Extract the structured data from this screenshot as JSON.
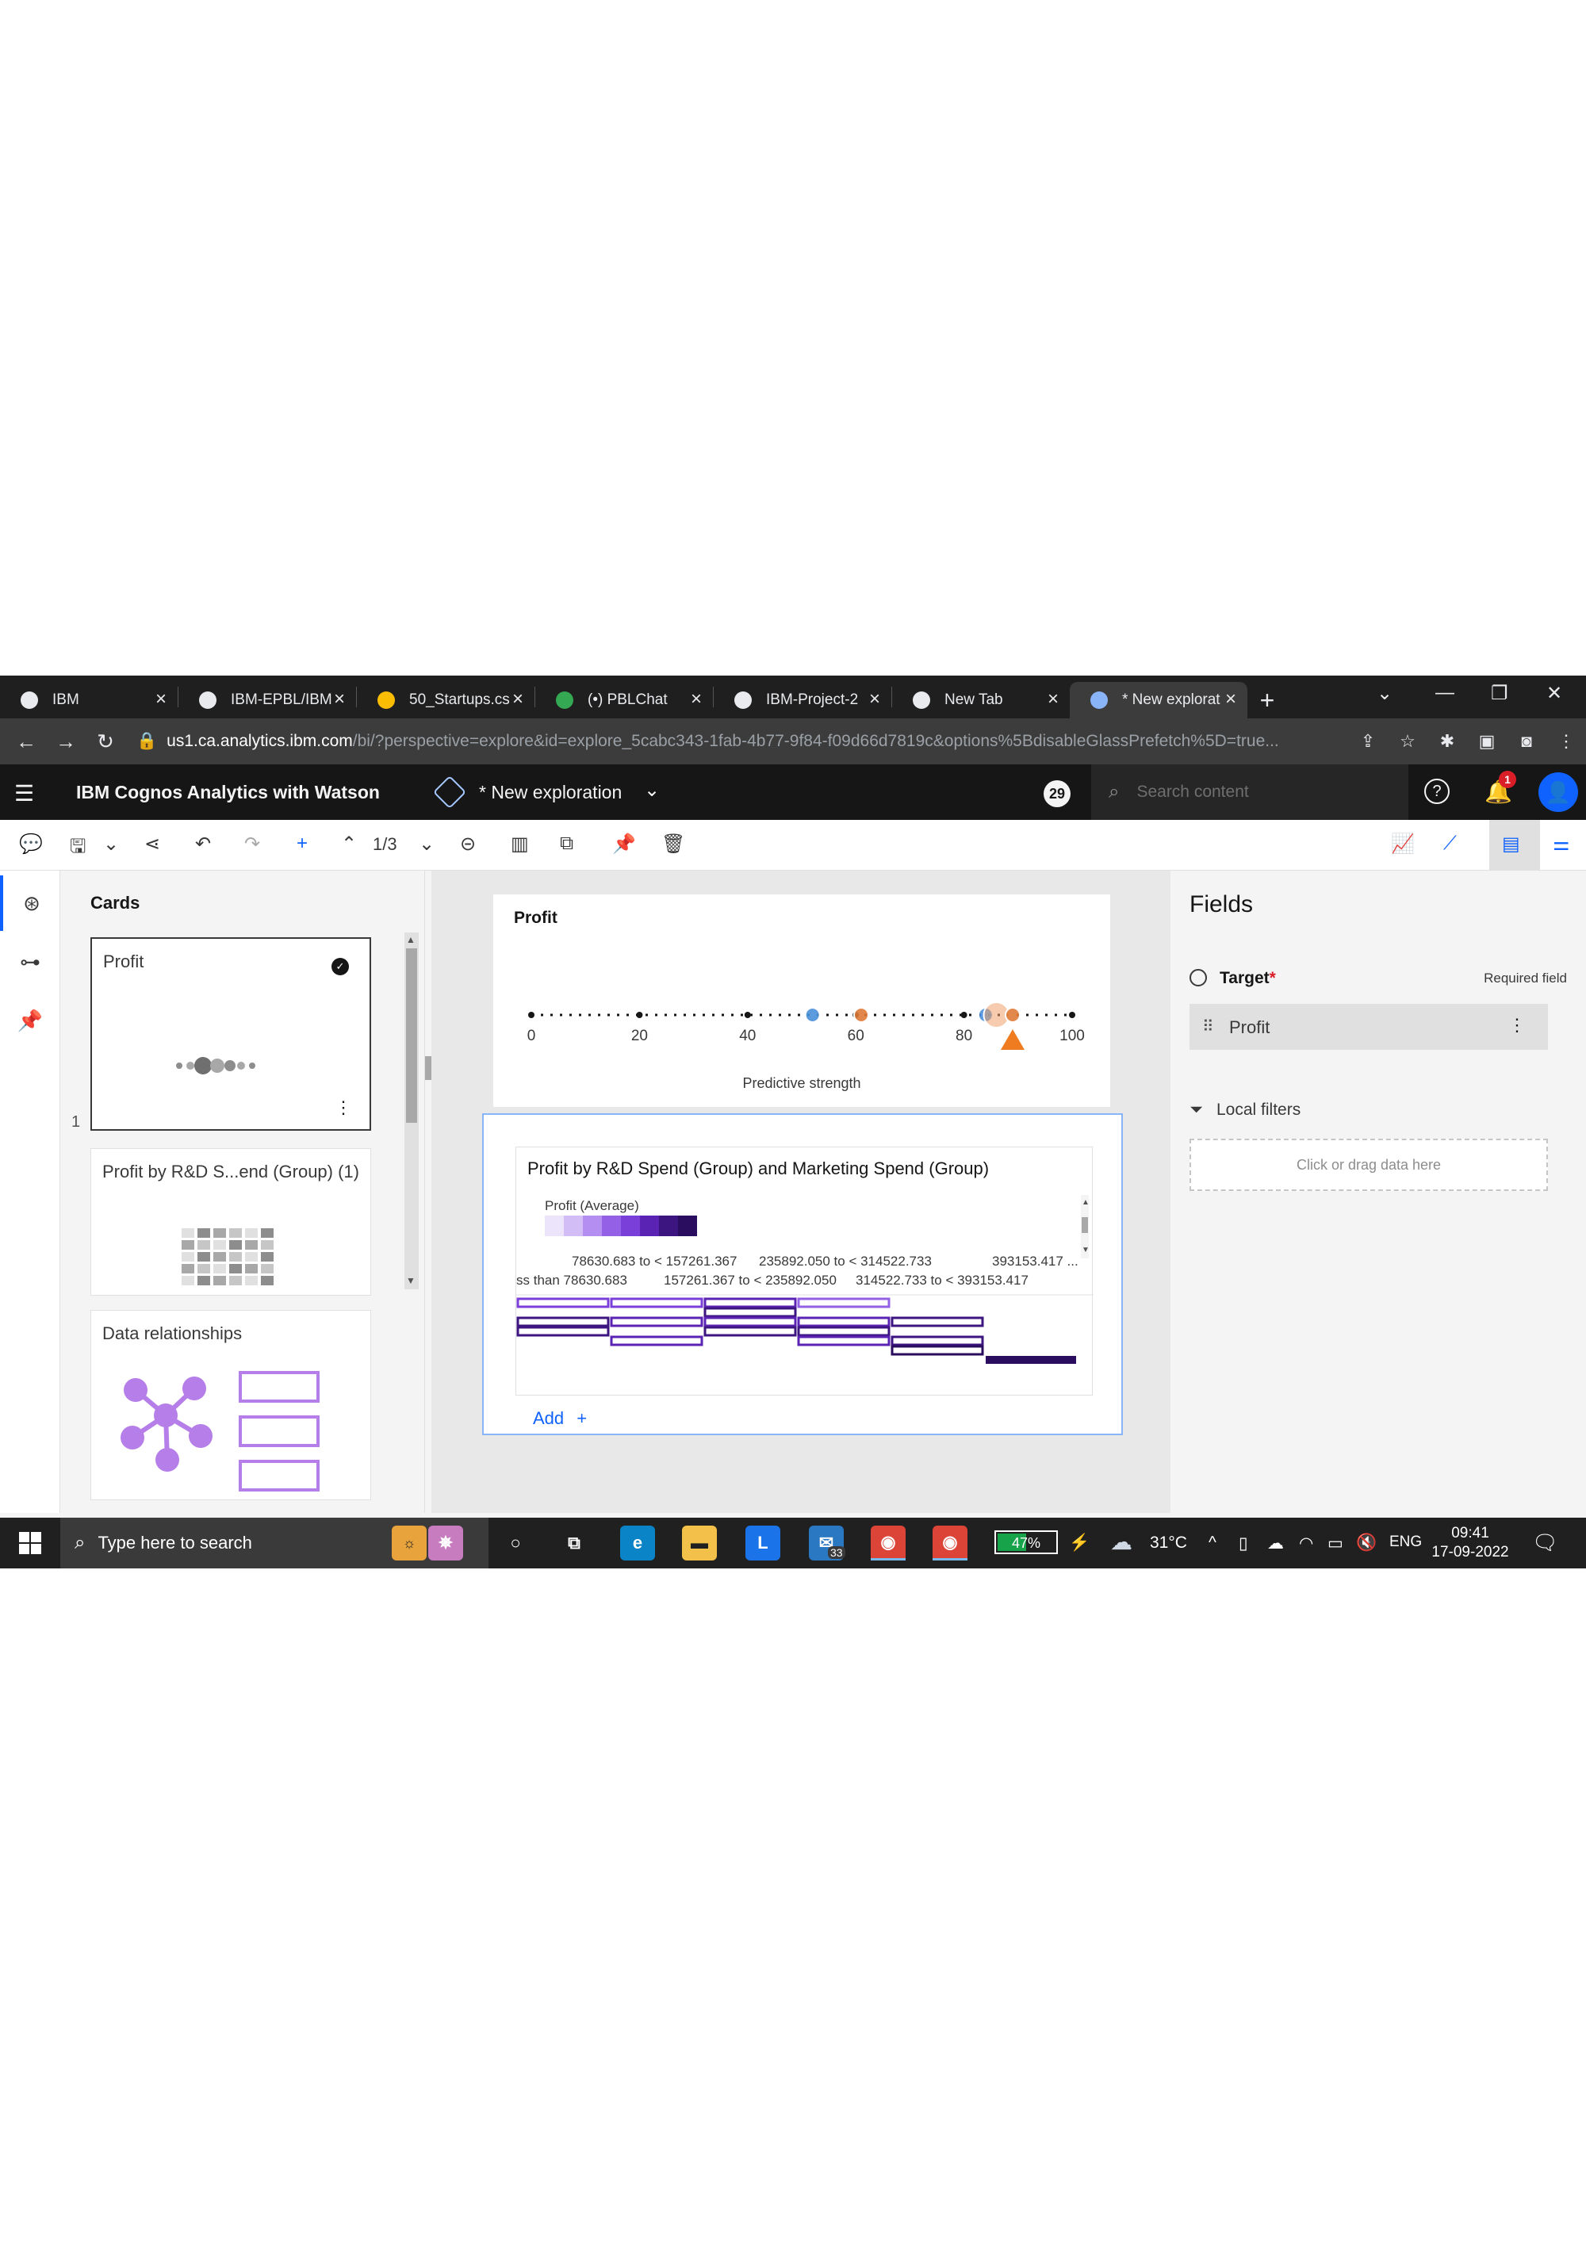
{
  "browser": {
    "tabs": [
      {
        "label": "IBM",
        "icon": "ibm-icon",
        "icon_color": "#e8eaed"
      },
      {
        "label": "IBM-EPBL/IBM",
        "icon": "github-icon",
        "icon_color": "#e8eaed"
      },
      {
        "label": "50_Startups.cs",
        "icon": "google-drive-icon",
        "icon_color": "#fbbc04"
      },
      {
        "label": "(•) PBLChat",
        "icon": "chat-icon",
        "icon_color": "#34a853"
      },
      {
        "label": "IBM-Project-2",
        "icon": "github-icon",
        "icon_color": "#e8eaed"
      },
      {
        "label": "New Tab",
        "icon": "chrome-icon",
        "icon_color": "#e8eaed"
      },
      {
        "label": "* New explorat",
        "icon": "cognos-icon",
        "icon_color": "#8ab4f8",
        "active": true
      }
    ],
    "new_tab_symbol": "+",
    "url_host": "us1.ca.analytics.ibm.com",
    "url_path": "/bi/?perspective=explore&id=explore_5cabc343-1fab-4b77-9f84-f09d66d7819c&options%5BdisableGlassPrefetch%5D=true..."
  },
  "app": {
    "product_title": "IBM Cognos Analytics with Watson",
    "exploration_name": "* New exploration",
    "counter": "29",
    "search_placeholder": "Search content",
    "notification_count": "1"
  },
  "toolbar": {
    "page_indicator": "1/3"
  },
  "cards_panel": {
    "title": "Cards",
    "cards": [
      {
        "title": "Profit",
        "number": "1",
        "selected": true
      },
      {
        "title": "Profit by R&D S...end (Group) (1)"
      },
      {
        "title": "Data relationships"
      }
    ]
  },
  "predictive_card": {
    "title": "Profit",
    "axis_label": "Predictive strength",
    "ticks": [
      "0",
      "20",
      "40",
      "60",
      "80",
      "100"
    ]
  },
  "chart_data": {
    "type": "scatter",
    "title": "Profit",
    "xlabel": "Predictive strength",
    "xlim": [
      0,
      100
    ],
    "points": [
      {
        "x": 52,
        "color": "#4a90d9"
      },
      {
        "x": 61,
        "color": "#e07b39"
      },
      {
        "x": 84,
        "color": "#4a90d9"
      },
      {
        "x": 86,
        "color": "#f0a06a"
      },
      {
        "x": 89,
        "color": "#e07b39"
      }
    ],
    "marker_x": 89
  },
  "heatmap_card": {
    "title": "Profit by R&D Spend (Group) and Marketing Spend (Group)",
    "legend_title": "Profit (Average)",
    "legend_colors": [
      "#ece4fb",
      "#d2bdf7",
      "#b48ef0",
      "#9461e6",
      "#7b3fd9",
      "#5b23b3",
      "#3d1580",
      "#2a0d5e"
    ],
    "col_labels_top": [
      "78630.683 to < 157261.367",
      "235892.050 to < 314522.733",
      "393153.417 ..."
    ],
    "col_labels_bottom": [
      "ss than 78630.683",
      "157261.367 to < 235892.050",
      "314522.733 to < 393153.417"
    ],
    "add_label": "Add"
  },
  "fields_panel": {
    "title": "Fields",
    "target_label": "Target",
    "required_star": "*",
    "required_text": "Required field",
    "target_value": "Profit",
    "local_filters_label": "Local filters",
    "drop_zone_text": "Click or drag data here"
  },
  "taskbar": {
    "search_placeholder": "Type here to search",
    "mail_count": "33",
    "battery": "47%",
    "weather": "31°C",
    "language": "ENG",
    "time": "09:41",
    "date": "17-09-2022"
  }
}
